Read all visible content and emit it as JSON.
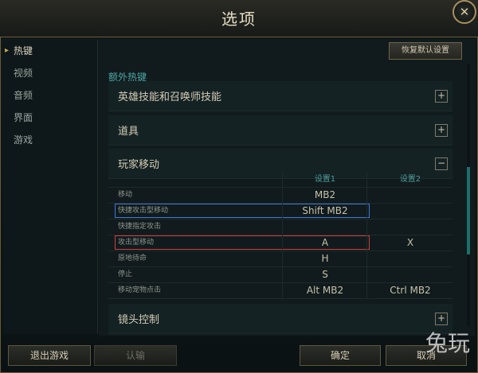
{
  "window": {
    "title": "选项",
    "close_glyph": "✕"
  },
  "sidebar": {
    "items": [
      {
        "label": "热键",
        "active": true
      },
      {
        "label": "视频",
        "active": false
      },
      {
        "label": "音频",
        "active": false
      },
      {
        "label": "界面",
        "active": false
      },
      {
        "label": "游戏",
        "active": false
      }
    ]
  },
  "main": {
    "restore_defaults_label": "恢复默认设置",
    "section_label": "额外热键",
    "groups": [
      {
        "title": "英雄技能和召唤师技能",
        "toggle": "+"
      },
      {
        "title": "道具",
        "toggle": "+"
      },
      {
        "title": "玩家移动",
        "toggle": "−"
      },
      {
        "title": "镜头控制",
        "toggle": "+"
      }
    ],
    "table": {
      "headers": {
        "setting1": "设置1",
        "setting2": "设置2"
      },
      "rows": [
        {
          "action": "移动",
          "setting1": "MB2",
          "setting2": ""
        },
        {
          "action": "快捷攻击型移动",
          "setting1": "Shift  MB2",
          "setting2": ""
        },
        {
          "action": "快捷指定攻击",
          "setting1": "",
          "setting2": ""
        },
        {
          "action": "攻击型移动",
          "setting1": "A",
          "setting2": "X"
        },
        {
          "action": "原地待命",
          "setting1": "H",
          "setting2": ""
        },
        {
          "action": "停止",
          "setting1": "S",
          "setting2": ""
        },
        {
          "action": "移动宠物点击",
          "setting1": "Alt  MB2",
          "setting2": "Ctrl  MB2"
        }
      ]
    }
  },
  "footer": {
    "exit_game_label": "退出游戏",
    "surrender_label": "认输",
    "ok_label": "确定",
    "cancel_label": "取消"
  },
  "watermark": "兔玩",
  "colors": {
    "accent_teal": "#4ea8a8",
    "highlight_blue": "#3f7ad8",
    "highlight_red": "#d23c3c",
    "gold_border": "#6d5a34"
  }
}
